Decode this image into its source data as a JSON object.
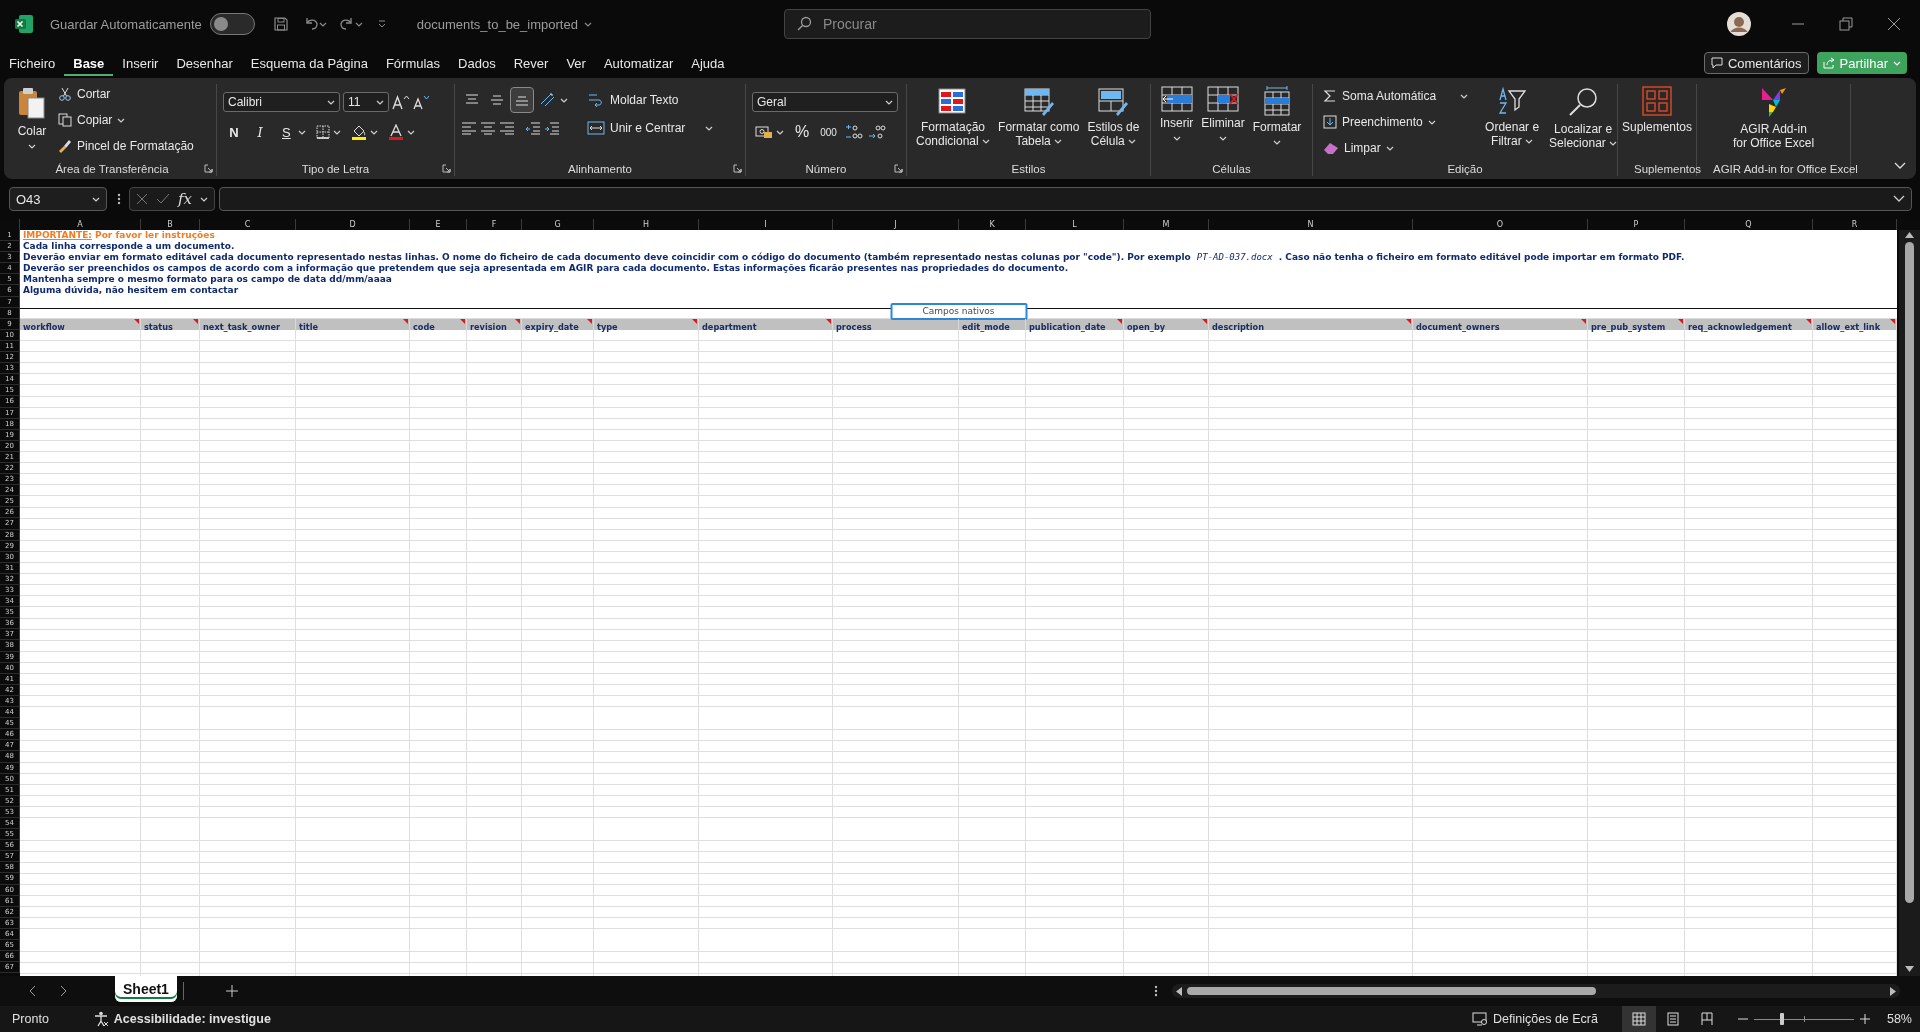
{
  "title_bar": {
    "autosave_label": "Guardar Automaticamente",
    "autosave_on": false,
    "filename": "documents_to_be_imported",
    "search_placeholder": "Procurar"
  },
  "menu_tabs": [
    {
      "label": "Ficheiro",
      "selected": false
    },
    {
      "label": "Base",
      "selected": true
    },
    {
      "label": "Inserir",
      "selected": false
    },
    {
      "label": "Desenhar",
      "selected": false
    },
    {
      "label": "Esquema da Página",
      "selected": false
    },
    {
      "label": "Fórmulas",
      "selected": false
    },
    {
      "label": "Dados",
      "selected": false
    },
    {
      "label": "Rever",
      "selected": false
    },
    {
      "label": "Ver",
      "selected": false
    },
    {
      "label": "Automatizar",
      "selected": false
    },
    {
      "label": "Ajuda",
      "selected": false
    }
  ],
  "comments_button": "Comentários",
  "share_button": "Partilhar",
  "ribbon": {
    "clipboard": {
      "title": "Área de Transferência",
      "paste": "Colar",
      "cut": "Cortar",
      "copy": "Copiar",
      "format_painter": "Pincel de Formatação"
    },
    "font": {
      "title": "Tipo de Letra",
      "font_name": "Calibri",
      "font_size": "11",
      "bold": "N",
      "italic": "I",
      "underline": "S"
    },
    "alignment": {
      "title": "Alinhamento",
      "wrap_text": "Moldar Texto",
      "merge_center": "Unir e Centrar",
      "vertical_align": [
        {
          "selected": false
        },
        {
          "selected": false
        },
        {
          "selected": true
        }
      ]
    },
    "number": {
      "title": "Número",
      "format": "Geral",
      "percent": "%",
      "thousands": "000"
    },
    "styles": {
      "title": "Estilos",
      "buttons": [
        {
          "lines": [
            "Formatação",
            "Condicional"
          ]
        },
        {
          "lines": [
            "Formatar como",
            "Tabela"
          ]
        },
        {
          "lines": [
            "Estilos de",
            "Célula"
          ]
        }
      ]
    },
    "cells": {
      "title": "Células",
      "buttons": [
        {
          "lines": [
            "Inserir"
          ]
        },
        {
          "lines": [
            "Eliminar"
          ]
        },
        {
          "lines": [
            "Formatar"
          ]
        }
      ]
    },
    "editing": {
      "title": "Edição",
      "autosum": "Soma Automática",
      "fill": "Preenchimento",
      "clear": "Limpar",
      "buttons": [
        {
          "lines": [
            "Ordenar e",
            "Filtrar"
          ]
        },
        {
          "lines": [
            "Localizar e",
            "Selecionar"
          ]
        }
      ]
    },
    "addins": {
      "title": "Suplementos",
      "button": {
        "lines": [
          "Suplementos"
        ]
      }
    },
    "agir": {
      "title": "AGIR Add-in for Office Excel",
      "button": {
        "lines": [
          "AGIR Add-in",
          "for Office Excel"
        ]
      }
    }
  },
  "formula_bar": {
    "name_box": "O43",
    "function_label": "fx"
  },
  "sheet": {
    "columns": [
      "A",
      "B",
      "C",
      "D",
      "E",
      "F",
      "G",
      "H",
      "I",
      "J",
      "K",
      "L",
      "M",
      "N",
      "O",
      "P",
      "Q",
      "R"
    ],
    "row_numbers": [
      "1",
      "2",
      "3",
      "4",
      "5",
      "6",
      "7",
      "8",
      "9",
      "10",
      "11",
      "12",
      "13",
      "14",
      "15",
      "16",
      "17",
      "18",
      "19",
      "20",
      "21",
      "22",
      "23",
      "24",
      "25",
      "26",
      "27",
      "28",
      "29",
      "30",
      "31",
      "32",
      "33",
      "34",
      "35",
      "36",
      "37",
      "38",
      "39",
      "40",
      "41",
      "42",
      "43",
      "44",
      "45",
      "46",
      "47",
      "48",
      "49",
      "50",
      "51",
      "52",
      "53",
      "54",
      "55",
      "56",
      "57",
      "58",
      "59",
      "60",
      "61",
      "62",
      "63",
      "64",
      "65",
      "66",
      "67"
    ],
    "instructions": [
      {
        "kind": "warning",
        "text": "**IMPORTANTE:** Por favor ler instruções"
      },
      {
        "kind": "note",
        "text": "Cada linha corresponde a um documento."
      },
      {
        "kind": "note",
        "text": "Deverão enviar em formato editável cada documento representado nestas linhas. O nome do ficheiro de cada documento deve coincidir com o código do documento (também representado nestas colunas por \"code\"). Por exemplo *PT-AD-037.docx* . Caso não tenha o ficheiro em formato editável pode importar em formato PDF."
      },
      {
        "kind": "note",
        "text": "Deverão ser preenchidos os campos de acordo com a informação que pretendem que seja apresentada em AGIR para cada documento. Estas informações ficarão presentes nas propriedades do documento."
      },
      {
        "kind": "note",
        "text": "Mantenha sempre o mesmo formato para os campo de data dd/mm/aaaa"
      },
      {
        "kind": "note",
        "text": "Alguma dúvida, não hesitem em contactar"
      }
    ],
    "section_label": "Campos nativos",
    "header_fields": [
      {
        "label": "workflow",
        "comment": true
      },
      {
        "label": "status",
        "comment": true
      },
      {
        "label": "next_task_owner",
        "comment": false
      },
      {
        "label": "title",
        "comment": true
      },
      {
        "label": "code",
        "comment": true
      },
      {
        "label": "revision",
        "comment": true
      },
      {
        "label": "expiry_date",
        "comment": true
      },
      {
        "label": "type",
        "comment": true
      },
      {
        "label": "department",
        "comment": true
      },
      {
        "label": "process",
        "comment": false
      },
      {
        "label": "edit_mode",
        "comment": false
      },
      {
        "label": "publication_date",
        "comment": true
      },
      {
        "label": "open_by",
        "comment": true
      },
      {
        "label": "description",
        "comment": true
      },
      {
        "label": "document_owners",
        "comment": true
      },
      {
        "label": "pre_pub_system",
        "comment": true
      },
      {
        "label": "req_acknowledgement",
        "comment": true
      },
      {
        "label": "allow_ext_link",
        "comment": true
      }
    ]
  },
  "sheet_tabs": [
    {
      "label": "Sheet1",
      "selected": true
    }
  ],
  "status_bar": {
    "status": "Pronto",
    "accessibility": "Acessibilidade: investigue",
    "display_settings": "Definições de Ecrã",
    "view_buttons": [
      {
        "selected": true
      },
      {
        "selected": false
      },
      {
        "selected": false
      }
    ],
    "zoom": {
      "level": 0.28,
      "reading": "58%"
    }
  }
}
